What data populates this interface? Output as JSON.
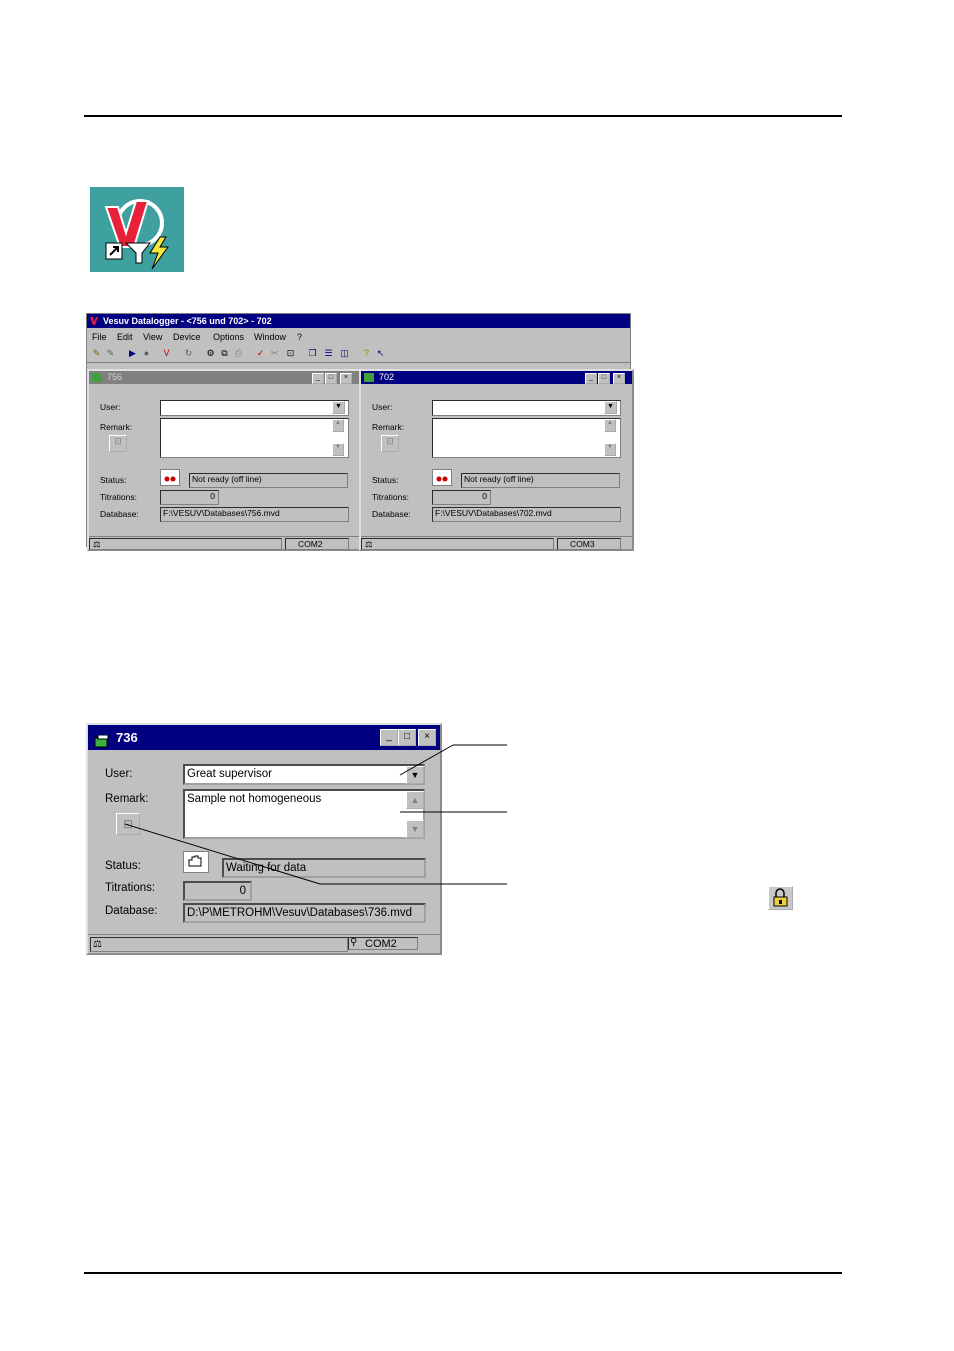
{
  "app": {
    "title": "Vesuv Datalogger - <756 und 702> - 702",
    "menu": [
      "File",
      "Edit",
      "View",
      "Device",
      "Options",
      "Window",
      "?"
    ]
  },
  "windows": [
    {
      "title": "756",
      "active": false,
      "user_label": "User:",
      "user_value": "",
      "remark_label": "Remark:",
      "remark_value": "",
      "status_label": "Status:",
      "status_value": "Not ready (off line)",
      "titrations_label": "Titrations:",
      "titrations_value": "0",
      "database_label": "Database:",
      "database_value": "F:\\VESUV\\Databases\\756.mvd",
      "port": "COM2"
    },
    {
      "title": "702",
      "active": true,
      "user_label": "User:",
      "user_value": "",
      "remark_label": "Remark:",
      "remark_value": "",
      "status_label": "Status:",
      "status_value": "Not ready (off line)",
      "titrations_label": "Titrations:",
      "titrations_value": "0",
      "database_label": "Database:",
      "database_value": "F:\\VESUV\\Databases\\702.mvd",
      "port": "COM3"
    }
  ],
  "detail": {
    "title": "736",
    "user_label": "User:",
    "user_value": "Great supervisor",
    "remark_label": "Remark:",
    "remark_value": "Sample not homogeneous",
    "status_label": "Status:",
    "status_value": "Waiting for data",
    "titrations_label": "Titrations:",
    "titrations_value": "0",
    "database_label": "Database:",
    "database_value": "D:\\P\\METROHM\\Vesuv\\Databases\\736.mvd",
    "port": "COM2"
  },
  "colors": {
    "title_active": "#000080",
    "title_inactive": "#808080",
    "window_face": "#c0c0c0",
    "icon_bg": "#3fa0a0"
  },
  "icons": [
    "vesuv-app-icon",
    "shortcut-arrow-icon",
    "funnel-icon",
    "lightning-icon",
    "instrument-icon",
    "edit-remark-icon",
    "status-led-icon",
    "hand-icon",
    "balance-icon",
    "plug-icon",
    "lock-icon"
  ]
}
